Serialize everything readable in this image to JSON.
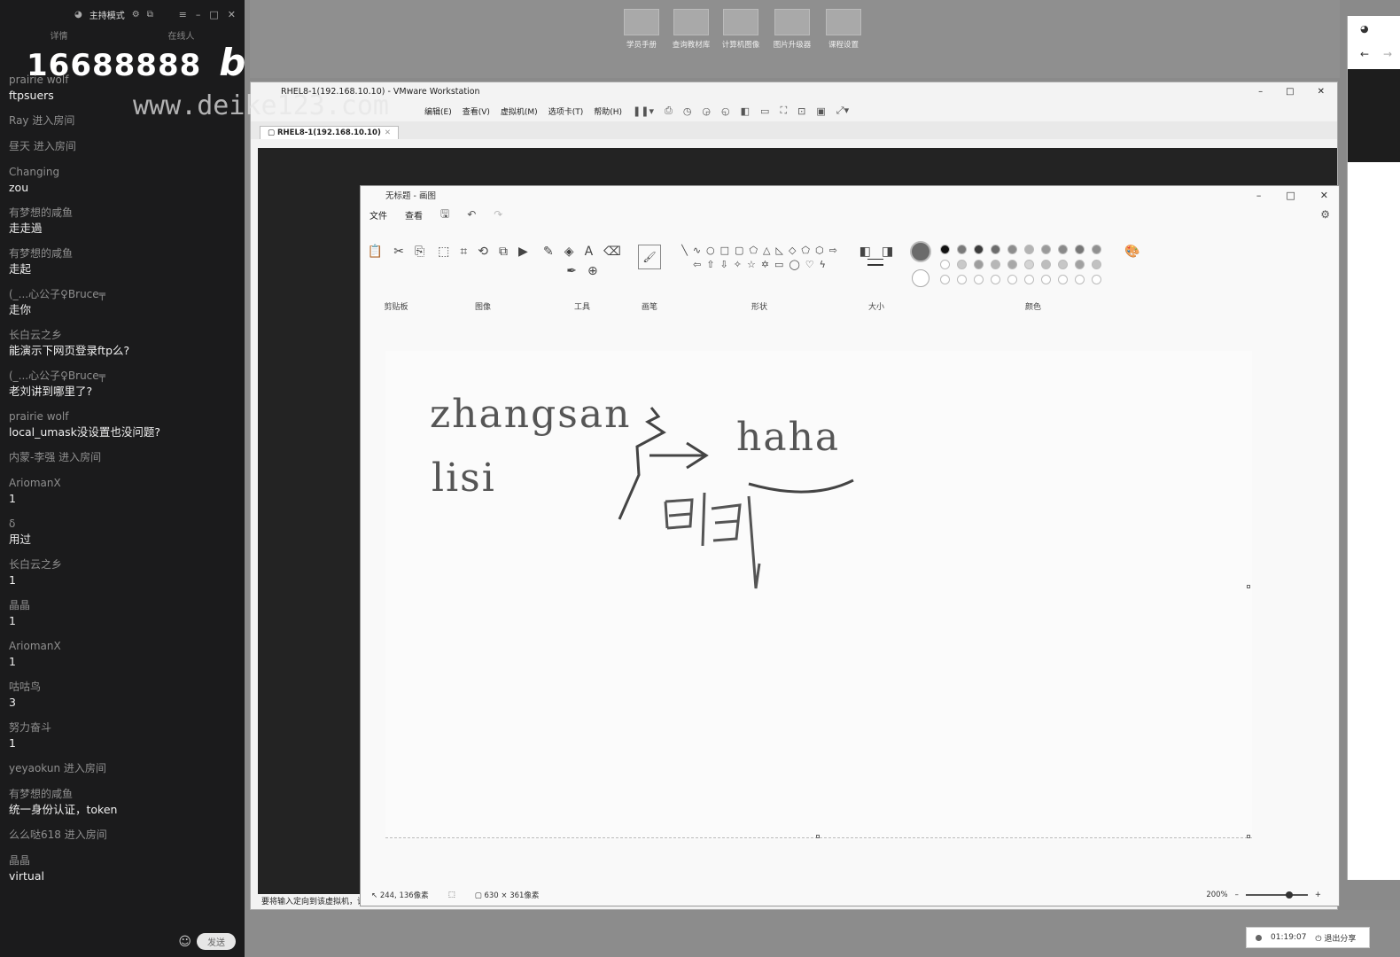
{
  "chat": {
    "mode": "主持模式",
    "tabs": [
      "详情",
      "在线人"
    ],
    "watermark_number": "16688888",
    "watermark_logo": "bilibili",
    "watermark_url": "www.deike123.com",
    "messages": [
      {
        "user": "prairie wolf",
        "text": "ftpsuers"
      },
      {
        "user": "Ray 进入房间",
        "text": ""
      },
      {
        "user": "昼天 进入房间",
        "text": ""
      },
      {
        "user": "Changing",
        "text": "zou"
      },
      {
        "user": "有梦想的咸鱼",
        "text": "走走過"
      },
      {
        "user": "有梦想的咸鱼",
        "text": "走起"
      },
      {
        "user": "(_...心公子♀Bruce╤",
        "text": "走你"
      },
      {
        "user": "长白云之乡",
        "text": "能演示下网页登录ftp么?"
      },
      {
        "user": "(_...心公子♀Bruce╤",
        "text": "老刘讲到哪里了?"
      },
      {
        "user": "prairie wolf",
        "text": "local_umask没设置也没问题?"
      },
      {
        "user": "内蒙-李强 进入房间",
        "text": ""
      },
      {
        "user": "AriomanX",
        "text": "1"
      },
      {
        "user": "δ",
        "text": "用过"
      },
      {
        "user": "长白云之乡",
        "text": "1"
      },
      {
        "user": "晶晶",
        "text": "1"
      },
      {
        "user": "AriomanX",
        "text": "1"
      },
      {
        "user": "咕咕鸟",
        "text": "3"
      },
      {
        "user": "努力奋斗",
        "text": "1"
      },
      {
        "user": "yeyaokun 进入房间",
        "text": ""
      },
      {
        "user": "有梦想的咸鱼",
        "text": "统一身份认证，token"
      },
      {
        "user": "么么哒618 进入房间",
        "text": ""
      },
      {
        "user": "晶晶",
        "text": "virtual"
      }
    ],
    "send_label": "发送"
  },
  "shortcuts": [
    "学员手册",
    "查询教材库",
    "计算机图像",
    "图片升级器",
    "课程设置"
  ],
  "vmware": {
    "title": "RHEL8-1(192.168.10.10) - VMware Workstation",
    "menu": [
      "编辑(E)",
      "查看(V)",
      "虚拟机(M)",
      "选项卡(T)",
      "帮助(H)"
    ],
    "tab": "RHEL8-1(192.168.10.10)",
    "status": "要将输入定向到该虚拟机，请"
  },
  "paint": {
    "title": "无标题 - 画图",
    "menu": [
      "文件",
      "查看"
    ],
    "groups": [
      "剪贴板",
      "图像",
      "工具",
      "画笔",
      "形状",
      "大小",
      "颜色"
    ],
    "canvas_text": [
      "zhangsan",
      "haha",
      "lisi"
    ],
    "status_cursor": "244, 136像素",
    "status_size": "630 × 361像素",
    "zoom": "200%",
    "colors_row1": [
      "#111111",
      "#7a7a7a",
      "#3b3b3b",
      "#6c6c6c",
      "#8d8d8d",
      "#b4b4b4",
      "#9a9a9a",
      "#8a8a8a",
      "#777777",
      "#909090"
    ],
    "colors_row2": [
      "#ffffff",
      "#c9c9c9",
      "#9d9d9d",
      "#b7b7b7",
      "#a8a8a8",
      "#d4d4d4",
      "#bdbdbd",
      "#c7c7c7",
      "#a1a1a1",
      "#c1c1c1"
    ]
  },
  "share": {
    "time": "01:19:07",
    "exit": "退出分享"
  }
}
